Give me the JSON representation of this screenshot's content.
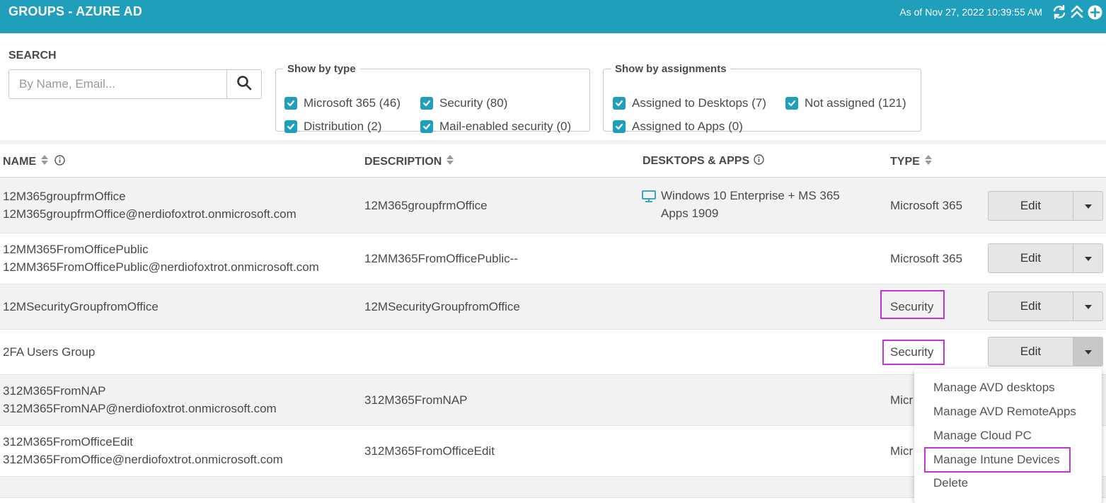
{
  "header": {
    "title": "GROUPS - AZURE AD",
    "as_of": "As of Nov 27, 2022 10:39:55 AM",
    "icons": [
      "refresh-icon",
      "collapse-icon",
      "add-icon"
    ]
  },
  "search": {
    "label": "SEARCH",
    "placeholder": "By Name, Email..."
  },
  "filter_type": {
    "legend": "Show by type",
    "options": [
      {
        "label": "Microsoft 365 (46)",
        "checked": true
      },
      {
        "label": "Security (80)",
        "checked": true
      },
      {
        "label": "Distribution (2)",
        "checked": true
      },
      {
        "label": "Mail-enabled security (0)",
        "checked": true
      }
    ]
  },
  "filter_assign": {
    "legend": "Show by assignments",
    "options": [
      {
        "label": "Assigned to Desktops (7)",
        "checked": true
      },
      {
        "label": "Not assigned (121)",
        "checked": true
      },
      {
        "label": "Assigned to Apps (0)",
        "checked": true
      }
    ]
  },
  "table": {
    "columns": [
      "NAME",
      "DESCRIPTION",
      "DESKTOPS & APPS",
      "TYPE"
    ],
    "rows": [
      {
        "name": "12M365groupfrmOffice",
        "email": "12M365groupfrmOffice@nerdiofoxtrot.onmicrosoft.com",
        "description": "12M365groupfrmOffice",
        "desktop": "Windows 10 Enterprise + MS 365 Apps 1909",
        "type": "Microsoft 365"
      },
      {
        "name": "12MM365FromOfficePublic",
        "email": "12MM365FromOfficePublic@nerdiofoxtrot.onmicrosoft.com",
        "description": "12MM365FromOfficePublic--",
        "desktop": "",
        "type": "Microsoft 365"
      },
      {
        "name": "12MSecurityGroupfromOffice",
        "email": "",
        "description": "12MSecurityGroupfromOffice",
        "desktop": "",
        "type": "Security"
      },
      {
        "name": "2FA Users Group",
        "email": "",
        "description": "",
        "desktop": "",
        "type": "Security"
      },
      {
        "name": "312M365FromNAP",
        "email": "312M365FromNAP@nerdiofoxtrot.onmicrosoft.com",
        "description": "312M365FromNAP",
        "desktop": "",
        "type": "Micr"
      },
      {
        "name": "312M365FromOfficeEdit",
        "email": "312M365FromOffice@nerdiofoxtrot.onmicrosoft.com",
        "description": "312M365FromOfficeEdit",
        "desktop": "",
        "type": "Micr"
      }
    ],
    "edit_label": "Edit"
  },
  "dropdown": {
    "items": [
      "Manage AVD desktops",
      "Manage AVD RemoteApps",
      "Manage Cloud PC",
      "Manage Intune Devices",
      "Delete"
    ]
  },
  "colors": {
    "accent": "#1f9fbc",
    "highlight": "#c433d3"
  }
}
